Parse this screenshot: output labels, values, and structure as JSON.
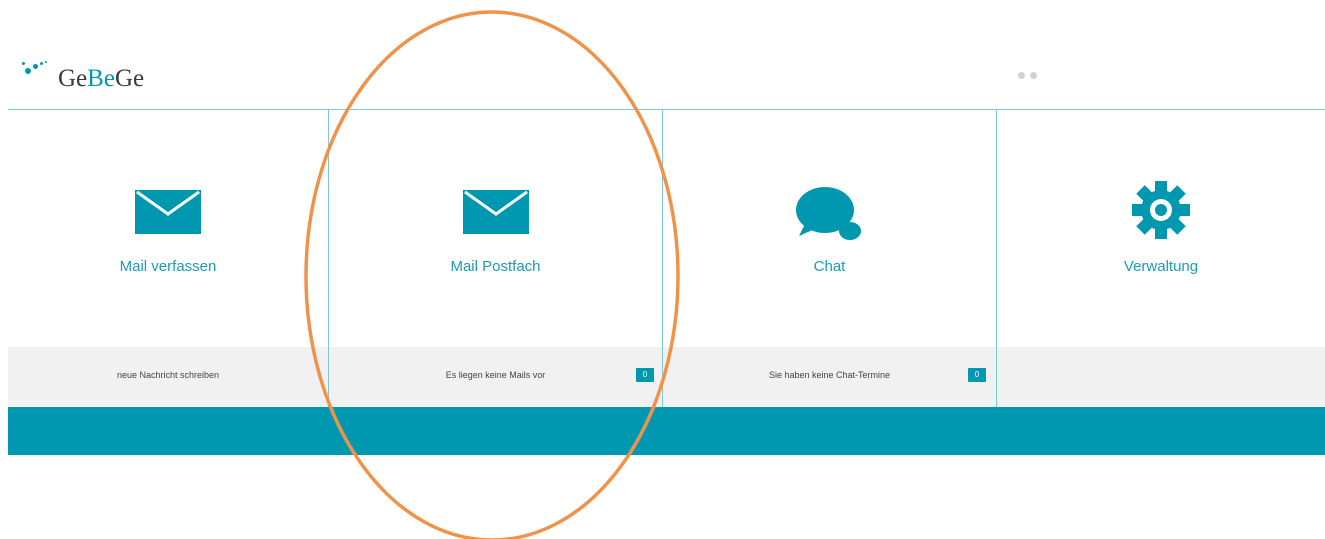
{
  "header": {
    "logo_prefix": "Ge",
    "logo_accent": "Be",
    "logo_suffix": "Ge"
  },
  "tiles": [
    {
      "title": "Mail verfassen",
      "footer_text": "neue Nachricht schreiben",
      "icon": "envelope-icon"
    },
    {
      "title": "Mail Postfach",
      "footer_text": "Es liegen keine Mails vor",
      "badge": "0",
      "icon": "envelope-icon"
    },
    {
      "title": "Chat",
      "footer_text": "Sie haben keine Chat-Termine",
      "badge": "0",
      "icon": "chat-bubble-icon"
    },
    {
      "title": "Verwaltung",
      "footer_text": "",
      "icon": "gear-icon"
    }
  ],
  "colors": {
    "accent": "#0098b0",
    "title_text": "#1b9cb2",
    "footer_bg": "#f1f1f1",
    "divider": "#7ec9d6",
    "highlight": "#f0934a"
  }
}
